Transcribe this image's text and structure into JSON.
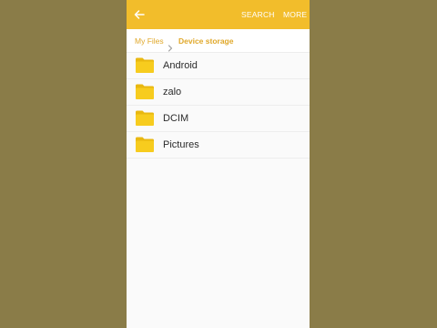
{
  "colors": {
    "appbar": "#f2bd2b",
    "accent_text": "#e0a82a",
    "folder": "#f7cc1e",
    "outer_background": "#8a7c48"
  },
  "appbar": {
    "back_icon": "arrow-left-icon",
    "search_label": "SEARCH",
    "more_label": "MORE"
  },
  "breadcrumb": {
    "root": "My Files",
    "separator_icon": "chevron-right-icon",
    "current": "Device storage"
  },
  "files": [
    {
      "name": "Android",
      "icon": "folder-icon"
    },
    {
      "name": "zalo",
      "icon": "folder-icon"
    },
    {
      "name": "DCIM",
      "icon": "folder-icon"
    },
    {
      "name": "Pictures",
      "icon": "folder-icon"
    }
  ]
}
